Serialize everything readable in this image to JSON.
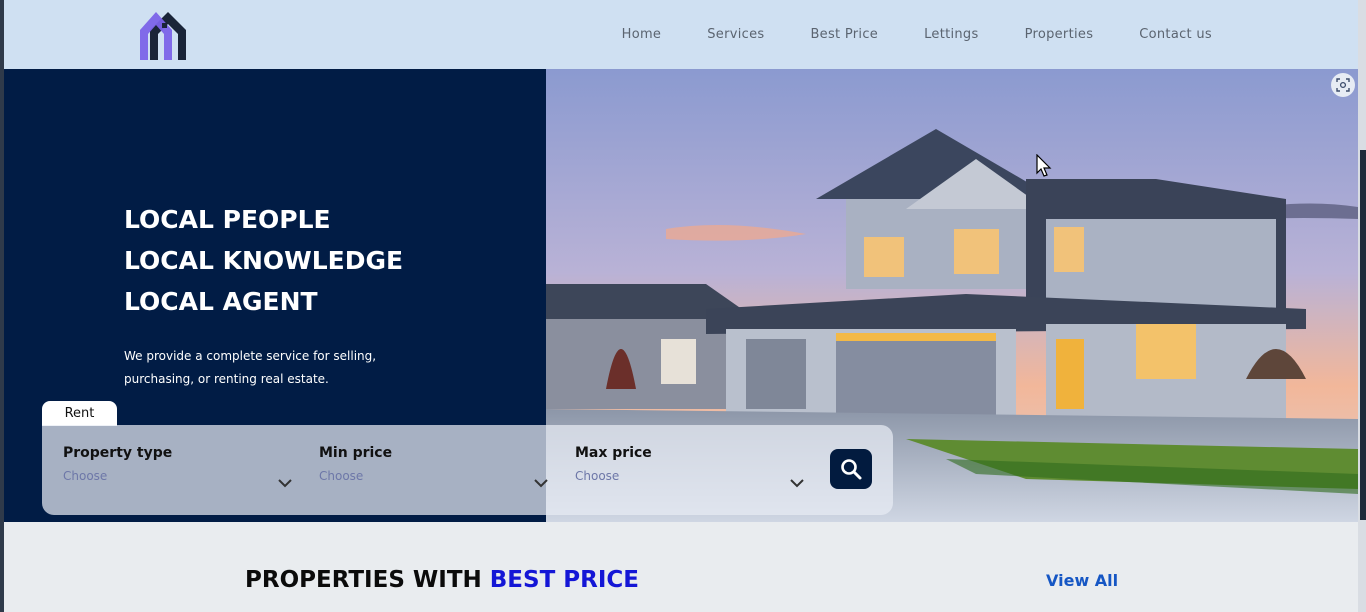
{
  "nav": {
    "items": [
      "Home",
      "Services",
      "Best Price",
      "Lettings",
      "Properties",
      "Contact us"
    ]
  },
  "hero": {
    "headline": [
      "LOCAL PEOPLE",
      "LOCAL KNOWLEDGE",
      "LOCAL AGENT"
    ],
    "subtext": "We provide a complete service for selling, purchasing, or renting real estate."
  },
  "search": {
    "tab_label": "Rent",
    "fields": [
      {
        "label": "Property type",
        "value": "Choose"
      },
      {
        "label": "Min price",
        "value": "Choose"
      },
      {
        "label": "Max price",
        "value": "Choose"
      }
    ],
    "button_icon": "search-icon"
  },
  "section": {
    "title_part1": "PROPERTIES WITH ",
    "title_part2": "BEST PRICE",
    "view_all": "View All"
  },
  "colors": {
    "header_bg": "#cfe0f2",
    "hero_dark": "#011c45",
    "accent_blue": "#1416d6",
    "link_blue": "#1556c4"
  }
}
